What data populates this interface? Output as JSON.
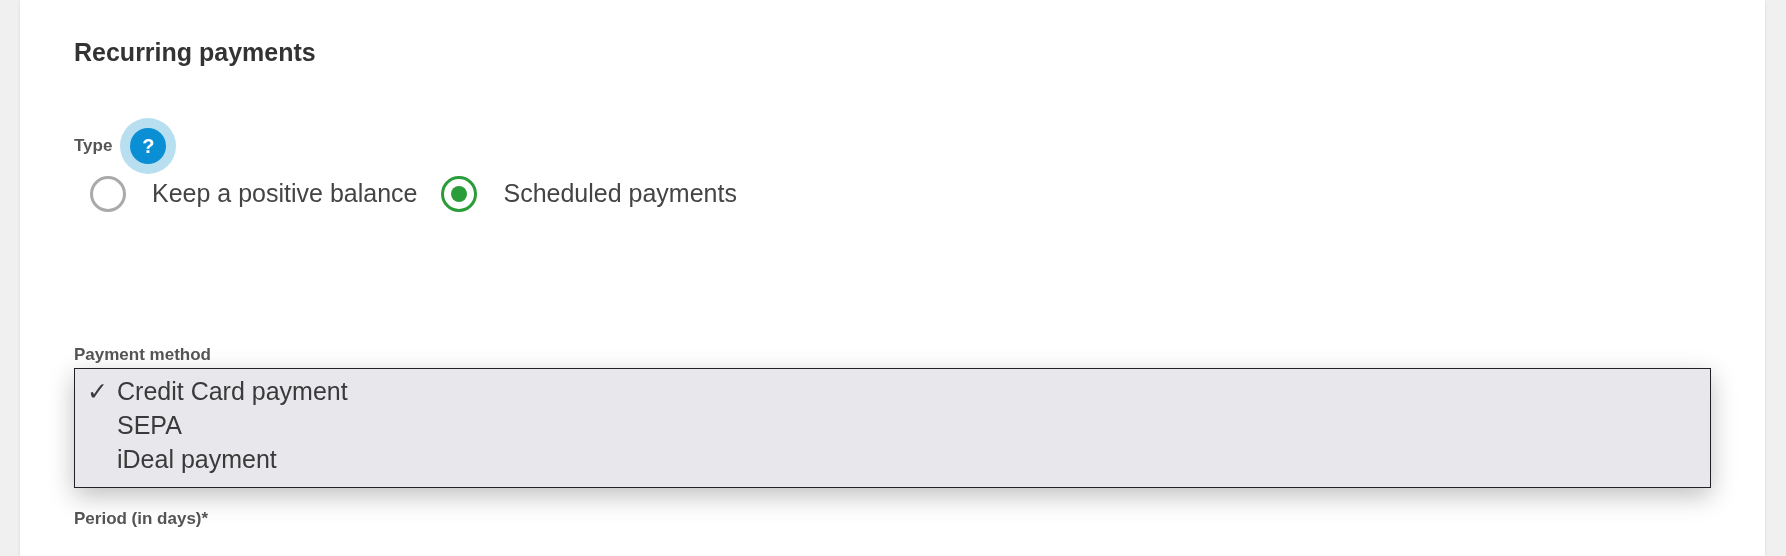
{
  "section": {
    "title": "Recurring payments"
  },
  "type_field": {
    "label": "Type",
    "help": "?",
    "options": [
      {
        "label": "Keep a positive balance",
        "selected": false
      },
      {
        "label": "Scheduled payments",
        "selected": true
      }
    ]
  },
  "payment_method": {
    "label": "Payment method",
    "check_mark": "✓",
    "options": [
      {
        "label": "Credit Card payment",
        "selected": true
      },
      {
        "label": "SEPA",
        "selected": false
      },
      {
        "label": "iDeal payment",
        "selected": false
      }
    ]
  },
  "period": {
    "label": "Period (in days)*"
  }
}
